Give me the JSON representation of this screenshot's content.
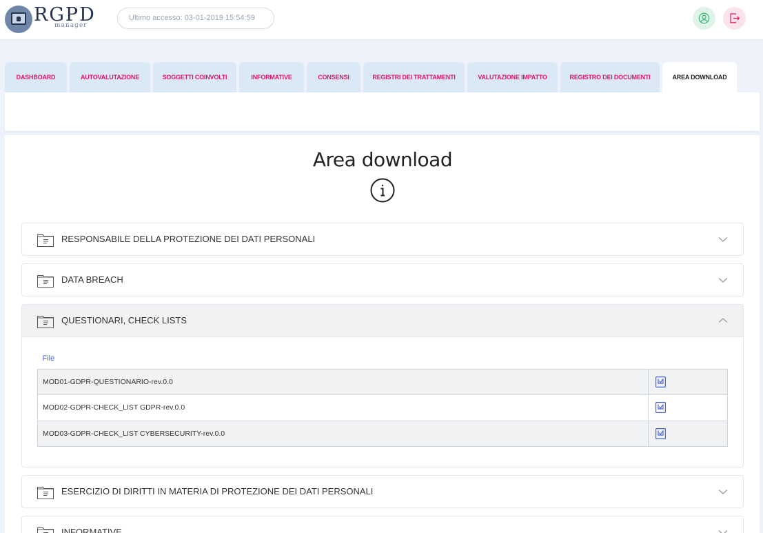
{
  "header": {
    "logo_text": "RGPD",
    "logo_subtext": "manager",
    "last_access": "Ultimo accesso: 03-01-2019 15:54:59",
    "icons": {
      "profile": "user-circle-icon",
      "logout": "logout-icon"
    }
  },
  "tabs": [
    {
      "label": "DASHBOARD",
      "active": false
    },
    {
      "label": "AUTOVALUTAZIONE",
      "active": false
    },
    {
      "label": "SOGGETTI COINVOLTI",
      "active": false
    },
    {
      "label": "INFORMATIVE",
      "active": false
    },
    {
      "label": "CONSENSI",
      "active": false
    },
    {
      "label": "REGISTRI DEI TRATTAMENTI",
      "active": false
    },
    {
      "label": "VALUTAZIONE IMPATTO",
      "active": false
    },
    {
      "label": "REGISTRO DEI DOCUMENTI",
      "active": false
    },
    {
      "label": "AREA DOWNLOAD",
      "active": true
    }
  ],
  "main": {
    "title": "Area download",
    "sections": [
      {
        "label": "RESPONSABILE DELLA PROTEZIONE DEI DATI PERSONALI",
        "expanded": false
      },
      {
        "label": "DATA BREACH",
        "expanded": false
      },
      {
        "label": "QUESTIONARI, CHECK LISTS",
        "expanded": true
      },
      {
        "label": "ESERCIZIO DI DIRITTI IN MATERIA DI PROTEZIONE DEI DATI PERSONALI",
        "expanded": false
      },
      {
        "label": "INFORMATIVE",
        "expanded": false
      }
    ],
    "files_table": {
      "header": "File",
      "rows": [
        "MOD01-GDPR-QUESTIONARIO-rev.0.0",
        "MOD02-GDPR-CHECK_LIST GDPR-rev.0.0",
        "MOD03-GDPR-CHECK_LIST CYBERSECURITY-rev.0.0"
      ]
    }
  },
  "colors": {
    "accent": "#e2156a",
    "link": "#4a63d6",
    "tab_bg": "#dbe9f6",
    "page_bg": "#eef3fb"
  }
}
